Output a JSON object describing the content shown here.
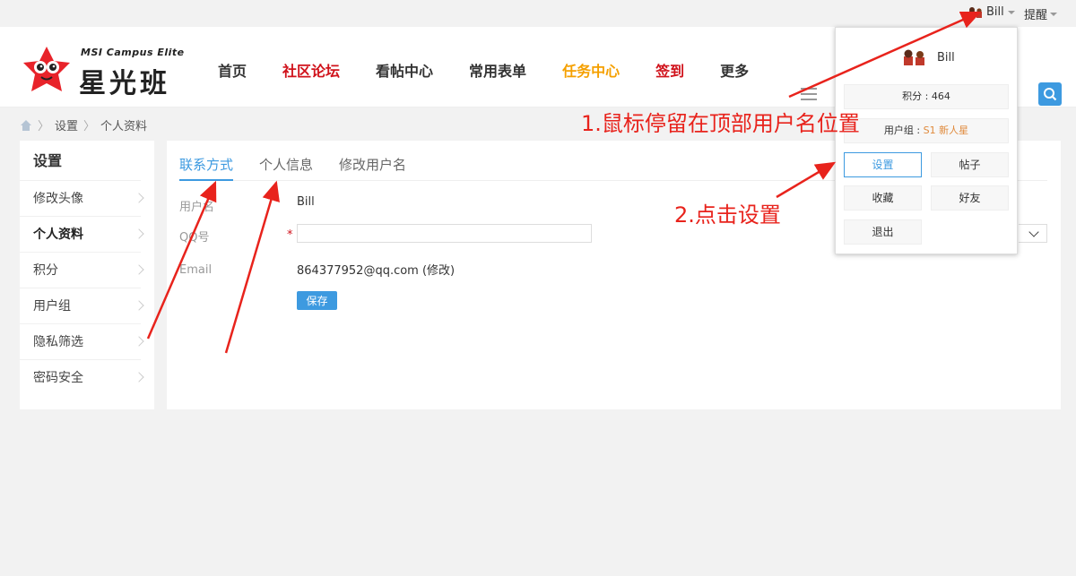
{
  "topbar": {
    "username": "Bill",
    "remind": "提醒"
  },
  "logo": {
    "en": "MSI Campus Elite",
    "cn": "星光班"
  },
  "nav": [
    {
      "label": "首页",
      "color": "dark"
    },
    {
      "label": "社区论坛",
      "color": "red"
    },
    {
      "label": "看帖中心",
      "color": "dark"
    },
    {
      "label": "常用表单",
      "color": "dark"
    },
    {
      "label": "任务中心",
      "color": "orange"
    },
    {
      "label": "签到",
      "color": "red"
    },
    {
      "label": "更多",
      "color": "dark"
    }
  ],
  "breadcrumb": {
    "item1": "设置",
    "item2": "个人资料",
    "separator": "〉"
  },
  "sidebar": {
    "title": "设置",
    "items": [
      {
        "label": "修改头像",
        "active": false
      },
      {
        "label": "个人资料",
        "active": true
      },
      {
        "label": "积分",
        "active": false
      },
      {
        "label": "用户组",
        "active": false
      },
      {
        "label": "隐私筛选",
        "active": false
      },
      {
        "label": "密码安全",
        "active": false
      }
    ]
  },
  "tabs": [
    {
      "label": "联系方式",
      "active": true
    },
    {
      "label": "个人信息",
      "active": false
    },
    {
      "label": "修改用户名",
      "active": false
    }
  ],
  "form": {
    "username_label": "用户名",
    "username_value": "Bill",
    "qq_label": "QQ号",
    "qq_required": "*",
    "qq_value": "",
    "email_label": "Email",
    "email_value": "864377952@qq.com (修改)",
    "save_label": "保存"
  },
  "dropdown": {
    "username": "Bill",
    "points": "积分 : 464",
    "group_prefix": "用户组 : ",
    "group_value": "S1 新人星",
    "settings": "设置",
    "posts": "帖子",
    "favorites": "收藏",
    "friends": "好友",
    "logout": "退出"
  },
  "annotations": {
    "step1": "1.鼠标停留在顶部用户名位置",
    "step2": "2.点击设置"
  },
  "colors": {
    "accent": "#3d9ae0",
    "red": "#d0121b",
    "orange": "#f5a000",
    "annotation": "#e8231c"
  },
  "icons": [
    "home-icon",
    "list-icon",
    "search-icon",
    "chevron-right-icon",
    "caret-down-icon",
    "avatar-icon",
    "star-mascot-icon"
  ]
}
